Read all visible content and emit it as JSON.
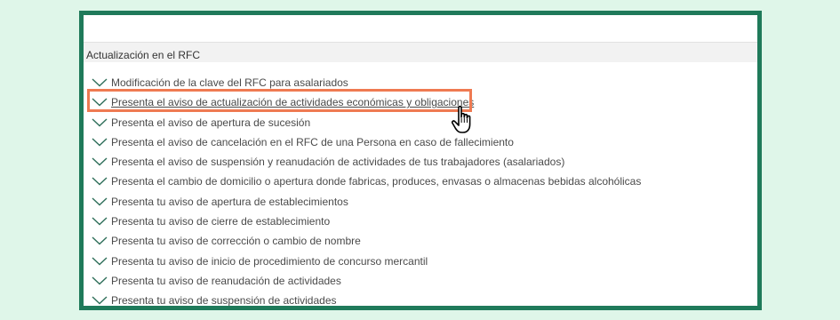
{
  "section": {
    "title": "Actualización en el RFC"
  },
  "items": [
    {
      "label": "Modificación de la clave del RFC para asalariados",
      "icon": "chevron-down-icon"
    },
    {
      "label": "Presenta el aviso de actualización de actividades económicas y obligaciones",
      "icon": "chevron-down-icon",
      "highlighted": true
    },
    {
      "label": "Presenta el aviso de apertura de sucesión",
      "icon": "chevron-down-icon"
    },
    {
      "label": "Presenta el aviso de cancelación en el RFC de una Persona en caso de fallecimiento",
      "icon": "chevron-down-icon"
    },
    {
      "label": "Presenta el aviso de suspensión y reanudación de actividades de tus trabajadores (asalariados)",
      "icon": "chevron-down-icon"
    },
    {
      "label": "Presenta el cambio de domicilio o apertura donde fabricas, produces, envasas o almacenas bebidas alcohólicas",
      "icon": "chevron-down-icon"
    },
    {
      "label": "Presenta tu aviso de apertura de establecimientos",
      "icon": "chevron-down-icon"
    },
    {
      "label": "Presenta tu aviso de cierre de establecimiento",
      "icon": "chevron-down-icon"
    },
    {
      "label": "Presenta tu aviso de corrección o cambio de nombre",
      "icon": "chevron-down-icon"
    },
    {
      "label": "Presenta tu aviso de inicio de procedimiento de concurso mercantil",
      "icon": "chevron-down-icon"
    },
    {
      "label": "Presenta tu aviso de reanudación de actividades",
      "icon": "chevron-down-icon"
    },
    {
      "label": "Presenta tu aviso de suspensión de actividades",
      "icon": "chevron-down-icon"
    }
  ],
  "colors": {
    "page_background": "#dff6e9",
    "frame_border": "#1f7a5a",
    "highlight": "#ef7a52",
    "text": "#4a4a4a",
    "chevron": "#2f6f5a"
  },
  "cursor": {
    "icon": "hand-pointer-icon"
  }
}
